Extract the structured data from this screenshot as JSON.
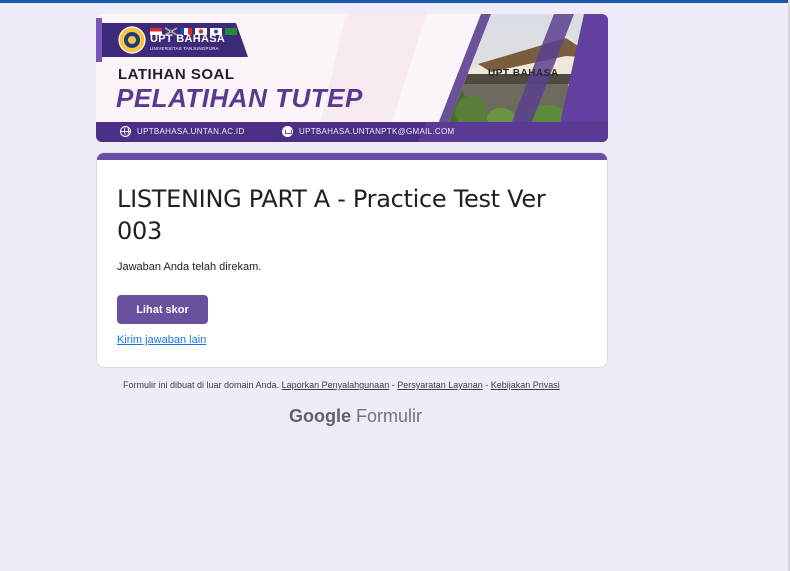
{
  "banner": {
    "brand_name": "UPT BAHASA",
    "brand_sub": "UNIVERSITAS TANJUNGPURA",
    "kicker": "LATIHAN SOAL",
    "title": "PELATIHAN TUTEP",
    "building_sign": "UPT BAHASA",
    "website": "UPTBAHASA.UNTAN.AC.ID",
    "email": "UPTBAHASA.UNTANPTK@GMAIL.COM",
    "colors": {
      "purple": "#5a3a8f",
      "banner_bg": "#fbf4f9"
    }
  },
  "form": {
    "title": "LISTENING PART A - Practice Test Ver 003",
    "confirmation": "Jawaban Anda telah direkam.",
    "score_button": "Lihat skor",
    "another_response_link": "Kirim jawaban lain",
    "accent_color": "#674ea7"
  },
  "footer": {
    "prefix": "Formulir ini dibuat di luar domain Anda.",
    "report_link": "Laporkan Penyalahgunaan",
    "sep1": " - ",
    "terms_link": "Persyaratan Layanan",
    "sep2": " - ",
    "privacy_link": "Kebijakan Privasi",
    "logo_google": "Google",
    "logo_forms": "Formulir"
  }
}
